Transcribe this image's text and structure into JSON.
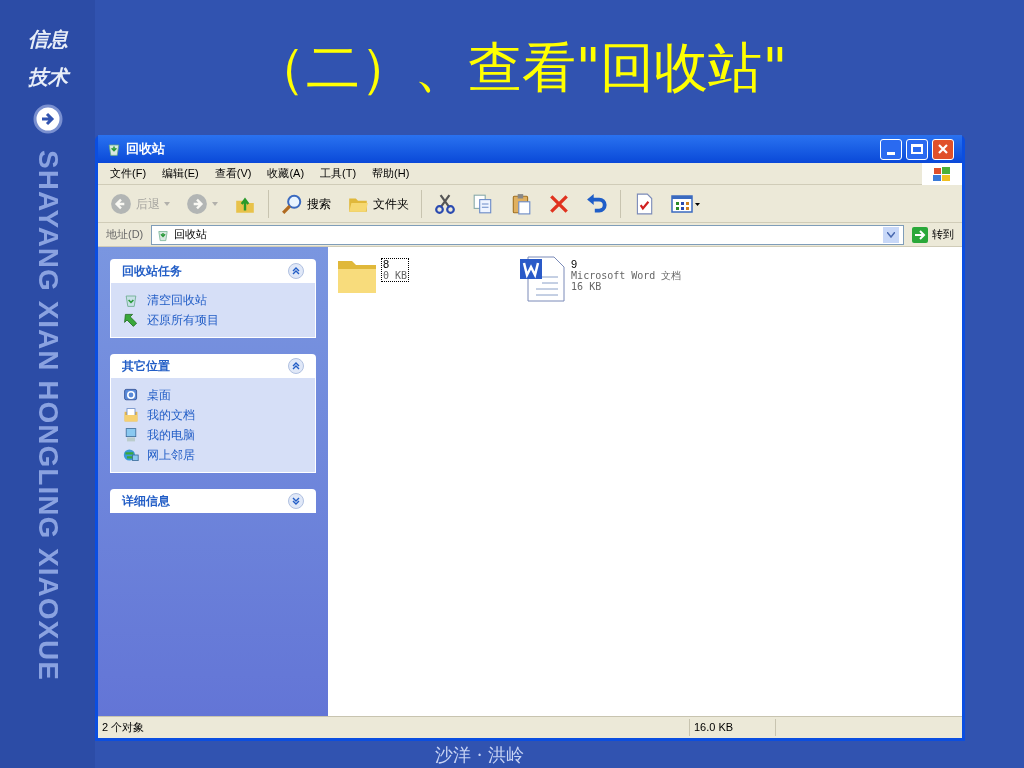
{
  "slide": {
    "logo_lines": [
      "信息",
      "技术"
    ],
    "title": "（二）、查看\"回收站\"",
    "side_text": "SHAYANG XIAN HONGLING XIAOXUE",
    "footer": "沙洋 · 洪岭"
  },
  "window": {
    "title": "回收站",
    "menu": [
      "文件(F)",
      "编辑(E)",
      "查看(V)",
      "收藏(A)",
      "工具(T)",
      "帮助(H)"
    ],
    "toolbar": [
      {
        "kind": "back",
        "label": "后退",
        "disabled": true
      },
      {
        "kind": "forward",
        "disabled": true
      },
      {
        "kind": "up",
        "disabled": false
      },
      {
        "kind": "search",
        "label": "搜索",
        "disabled": false
      },
      {
        "kind": "folders",
        "label": "文件夹",
        "disabled": false
      },
      {
        "kind": "cut",
        "disabled": false
      },
      {
        "kind": "copy",
        "disabled": false
      },
      {
        "kind": "paste",
        "disabled": false
      },
      {
        "kind": "delete",
        "disabled": false
      },
      {
        "kind": "undo",
        "disabled": false
      },
      {
        "kind": "properties",
        "disabled": false
      },
      {
        "kind": "views",
        "disabled": false
      }
    ],
    "address": {
      "label": "地址(D)",
      "value": "回收站",
      "go": "转到"
    },
    "panels": [
      {
        "title": "回收站任务",
        "expanded": true,
        "items": [
          {
            "kind": "empty",
            "label": "清空回收站"
          },
          {
            "kind": "restore",
            "label": "还原所有项目"
          }
        ]
      },
      {
        "title": "其它位置",
        "expanded": true,
        "items": [
          {
            "kind": "desktop",
            "label": "桌面"
          },
          {
            "kind": "documents",
            "label": "我的文档"
          },
          {
            "kind": "computer",
            "label": "我的电脑"
          },
          {
            "kind": "network",
            "label": "网上邻居"
          }
        ]
      },
      {
        "title": "详细信息",
        "expanded": false
      }
    ],
    "files": [
      {
        "kind": "folder",
        "name": "8",
        "details": [
          "0 KB"
        ],
        "selected": true
      },
      {
        "kind": "word",
        "name": "9",
        "details": [
          "Microsoft Word 文档",
          "16 KB"
        ],
        "selected": false
      }
    ],
    "status_bar": [
      "2 个对象",
      "16.0 KB"
    ]
  }
}
